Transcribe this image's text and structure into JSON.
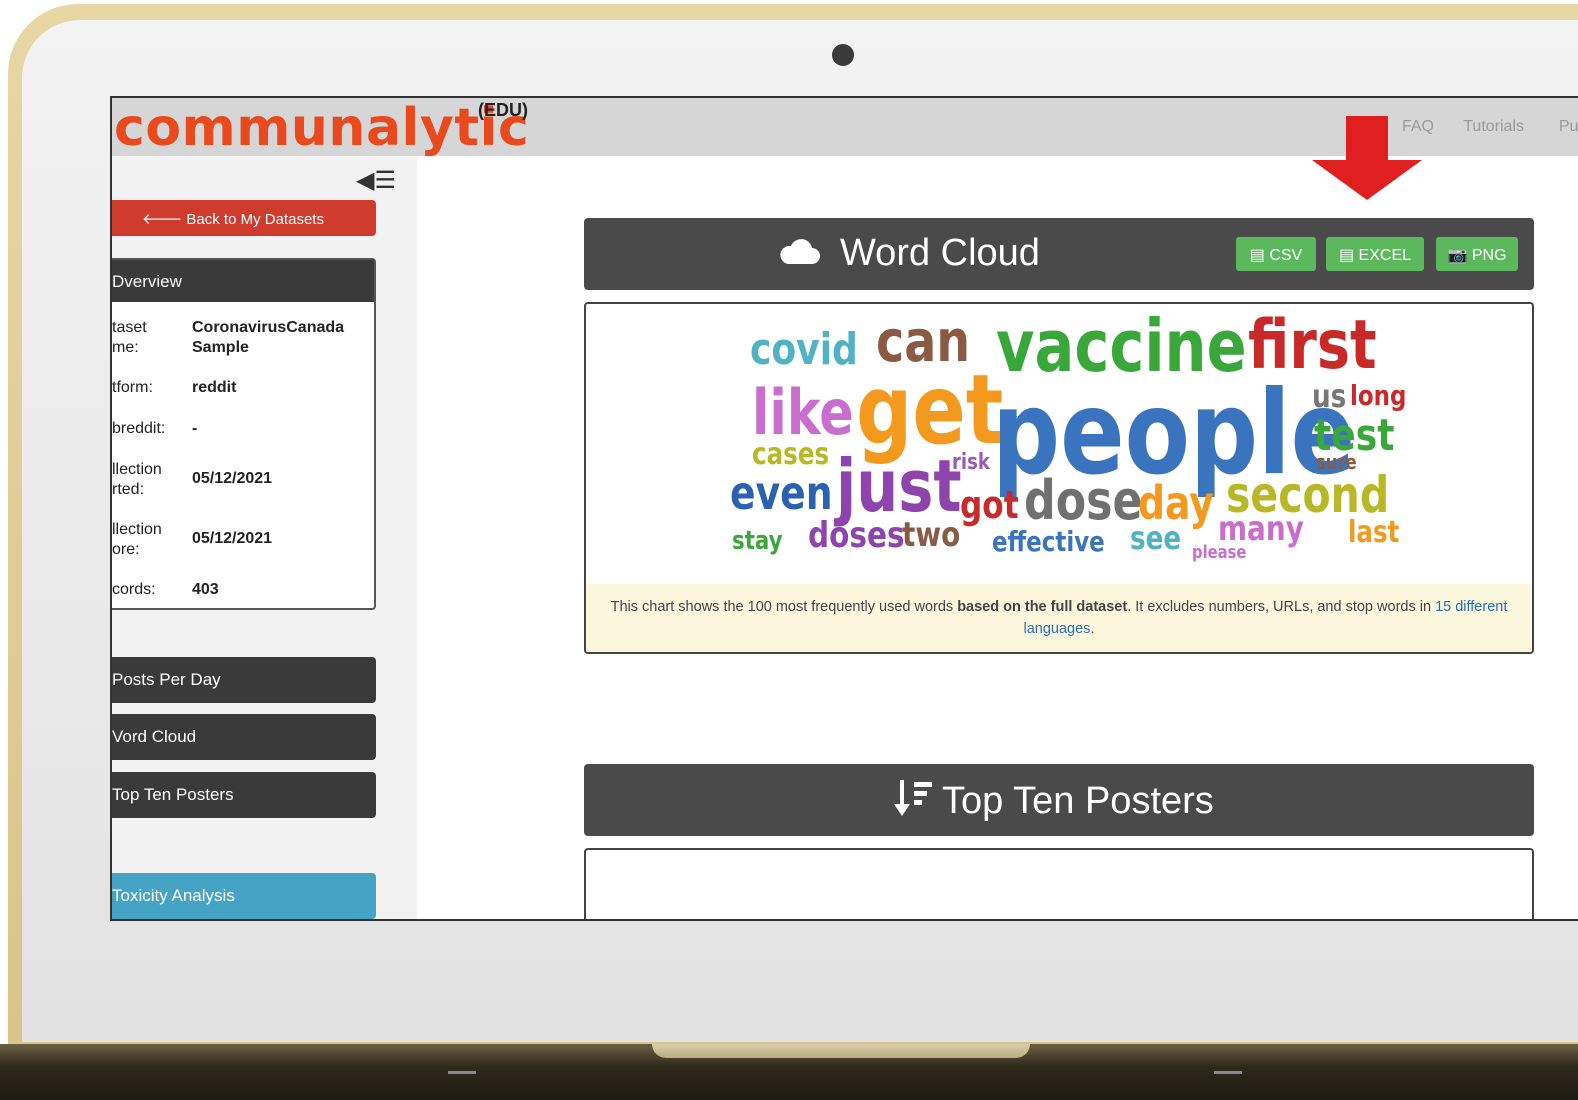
{
  "app": {
    "logo": "communalytic",
    "logo_badge": "(EDU)",
    "nav": [
      "FAQ",
      "Tutorials",
      "Pul"
    ]
  },
  "sidebar": {
    "collapse_icon": "collapse-menu-icon",
    "back_button": "Back to My Datasets",
    "overview": {
      "title": "Dverview",
      "rows": [
        {
          "label": "taset\nme:",
          "value": "CoronavirusCanada Sample"
        },
        {
          "label": "tform:",
          "value": "reddit"
        },
        {
          "label": "breddit:",
          "value": "-"
        },
        {
          "label": "llection\nrted:",
          "value": "05/12/2021"
        },
        {
          "label": "llection\nore:",
          "value": "05/12/2021"
        },
        {
          "label": "cords:",
          "value": "403"
        }
      ]
    },
    "buttons": [
      {
        "label": "Posts Per Day"
      },
      {
        "label": "Vord Cloud"
      },
      {
        "label": "Top Ten Posters"
      },
      {
        "label": "Toxicity Analysis"
      }
    ]
  },
  "word_cloud": {
    "title": "Word Cloud",
    "icon": "cloud-icon",
    "exports": [
      "CSV",
      "EXCEL",
      "PNG"
    ],
    "words": [
      {
        "text": "covid",
        "color": "#4fb3c4"
      },
      {
        "text": "can",
        "color": "#8a5a44"
      },
      {
        "text": "vaccine",
        "color": "#3aa73a"
      },
      {
        "text": "first",
        "color": "#c82a2a"
      },
      {
        "text": "like",
        "color": "#c86fce"
      },
      {
        "text": "get",
        "color": "#f39a1e"
      },
      {
        "text": "people",
        "color": "#3a74bf"
      },
      {
        "text": "us",
        "color": "#777777"
      },
      {
        "text": "long",
        "color": "#c82a2a"
      },
      {
        "text": "test",
        "color": "#3aa73a"
      },
      {
        "text": "cases",
        "color": "#b8b826"
      },
      {
        "text": "risk",
        "color": "#9b59b6"
      },
      {
        "text": "sure",
        "color": "#8a5a44"
      },
      {
        "text": "even",
        "color": "#2a62b0"
      },
      {
        "text": "just",
        "color": "#8e44ad"
      },
      {
        "text": "got",
        "color": "#c82a2a"
      },
      {
        "text": "dose",
        "color": "#707070"
      },
      {
        "text": "day",
        "color": "#f39a1e"
      },
      {
        "text": "second",
        "color": "#b8b826"
      },
      {
        "text": "stay",
        "color": "#3aa73a"
      },
      {
        "text": "doses",
        "color": "#8e44ad"
      },
      {
        "text": "two",
        "color": "#8a5a44"
      },
      {
        "text": "effective",
        "color": "#3a74bf"
      },
      {
        "text": "see",
        "color": "#4fb3c4"
      },
      {
        "text": "many",
        "color": "#c86fce"
      },
      {
        "text": "please",
        "color": "#c86fce"
      },
      {
        "text": "last",
        "color": "#f39a1e"
      }
    ],
    "note_prefix": "This chart shows the 100 most frequently used words ",
    "note_bold": "based on the full dataset",
    "note_mid": ". It excludes numbers, URLs, and stop words in ",
    "note_link": "15 different languages",
    "note_end": "."
  },
  "top_posters": {
    "title": "Top Ten Posters",
    "icon": "sort-amount-icon"
  },
  "annotation": {
    "arrow_color": "#e02020"
  }
}
